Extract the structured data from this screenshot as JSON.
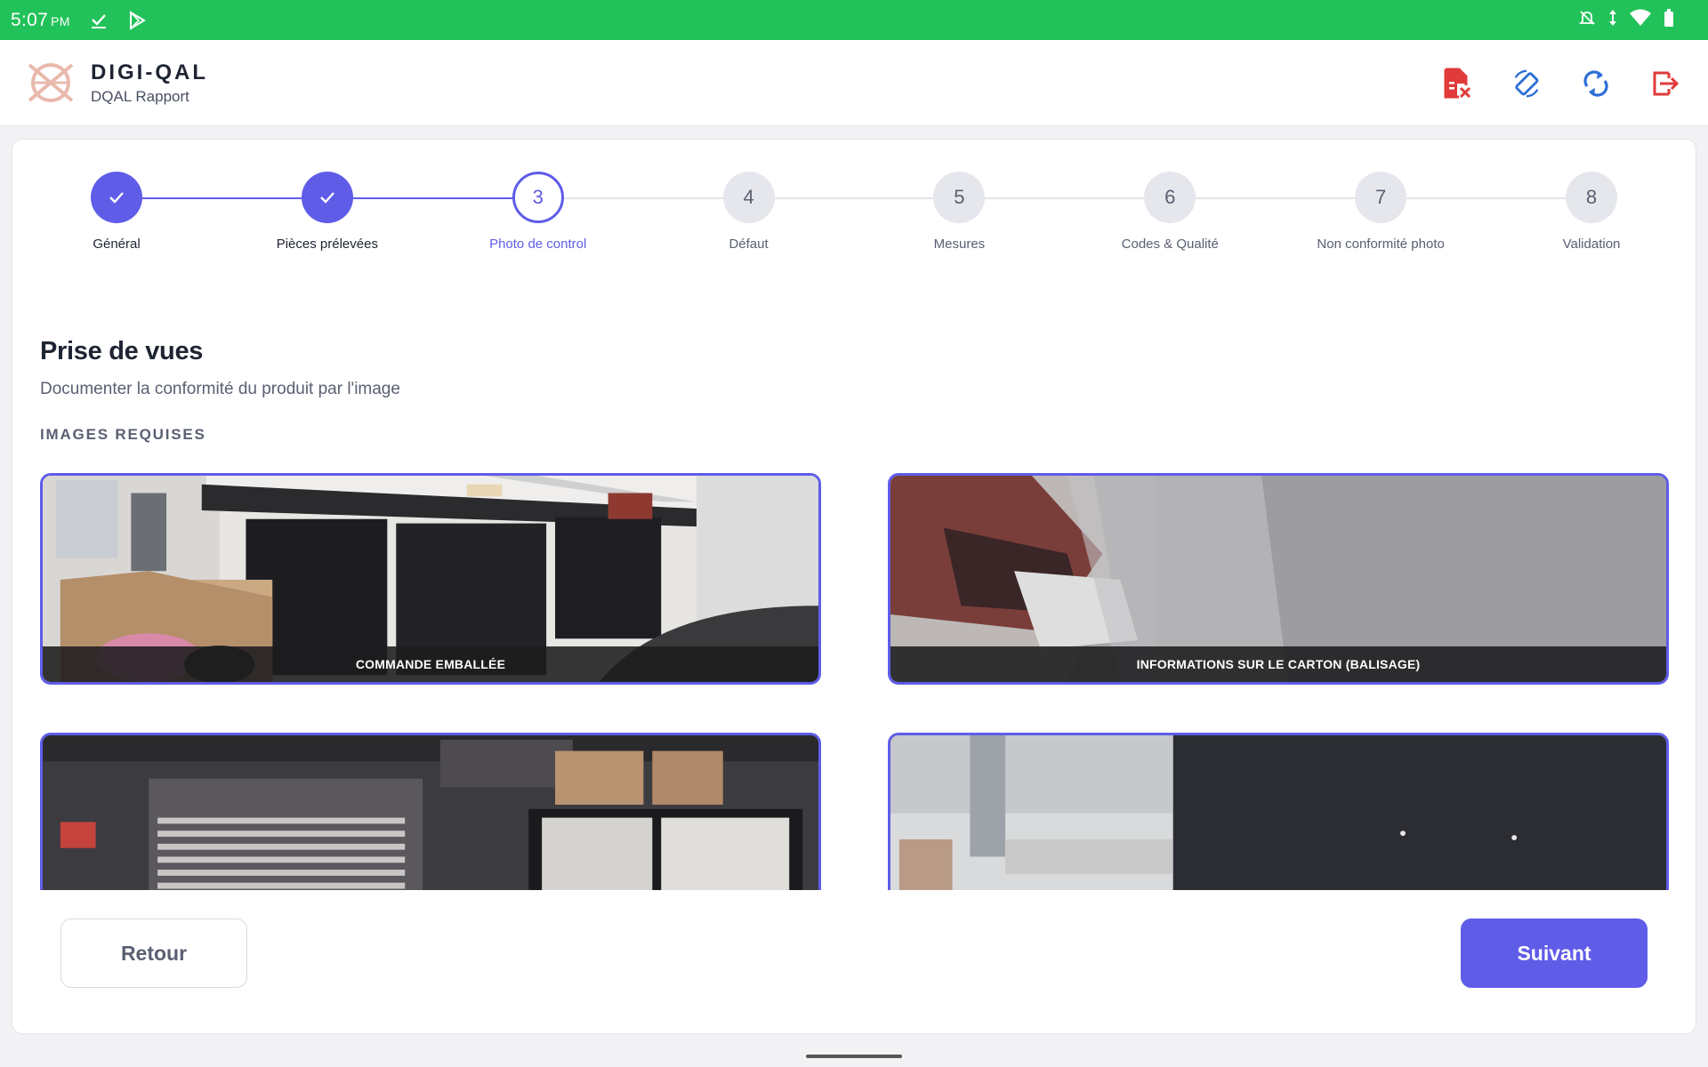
{
  "status_bar": {
    "time": "5:07",
    "ampm": "PM",
    "icons": [
      "download-done-icon",
      "play-store-icon",
      "notifications-off-icon",
      "data-arrows-icon",
      "wifi-icon",
      "battery-icon"
    ]
  },
  "header": {
    "app_name": "DIGI-QAL",
    "subtitle": "DQAL Rapport",
    "actions": [
      "delete-report-icon",
      "rotate-screen-icon",
      "sync-icon",
      "logout-icon"
    ],
    "colors": {
      "danger": "#e03a3a",
      "primary": "#2c6fd6"
    }
  },
  "stepper": {
    "steps": [
      {
        "label": "Général",
        "number": "1",
        "state": "done"
      },
      {
        "label": "Pièces prélevées",
        "number": "2",
        "state": "done"
      },
      {
        "label": "Photo de control",
        "number": "3",
        "state": "active"
      },
      {
        "label": "Défaut",
        "number": "4",
        "state": "pending"
      },
      {
        "label": "Mesures",
        "number": "5",
        "state": "pending"
      },
      {
        "label": "Codes & Qualité",
        "number": "6",
        "state": "pending"
      },
      {
        "label": "Non conformité photo",
        "number": "7",
        "state": "pending"
      },
      {
        "label": "Validation",
        "number": "8",
        "state": "pending"
      }
    ],
    "accent": "#5f5ce8"
  },
  "section": {
    "title": "Prise de vues",
    "description": "Documenter la conformité du produit par l'image",
    "label": "IMAGES REQUISES"
  },
  "photos": [
    {
      "caption": "COMMANDE EMBALLÉE"
    },
    {
      "caption": "INFORMATIONS SUR LE CARTON (BALISAGE)"
    },
    {
      "caption": ""
    },
    {
      "caption": ""
    }
  ],
  "footer": {
    "back_label": "Retour",
    "next_label": "Suivant"
  }
}
